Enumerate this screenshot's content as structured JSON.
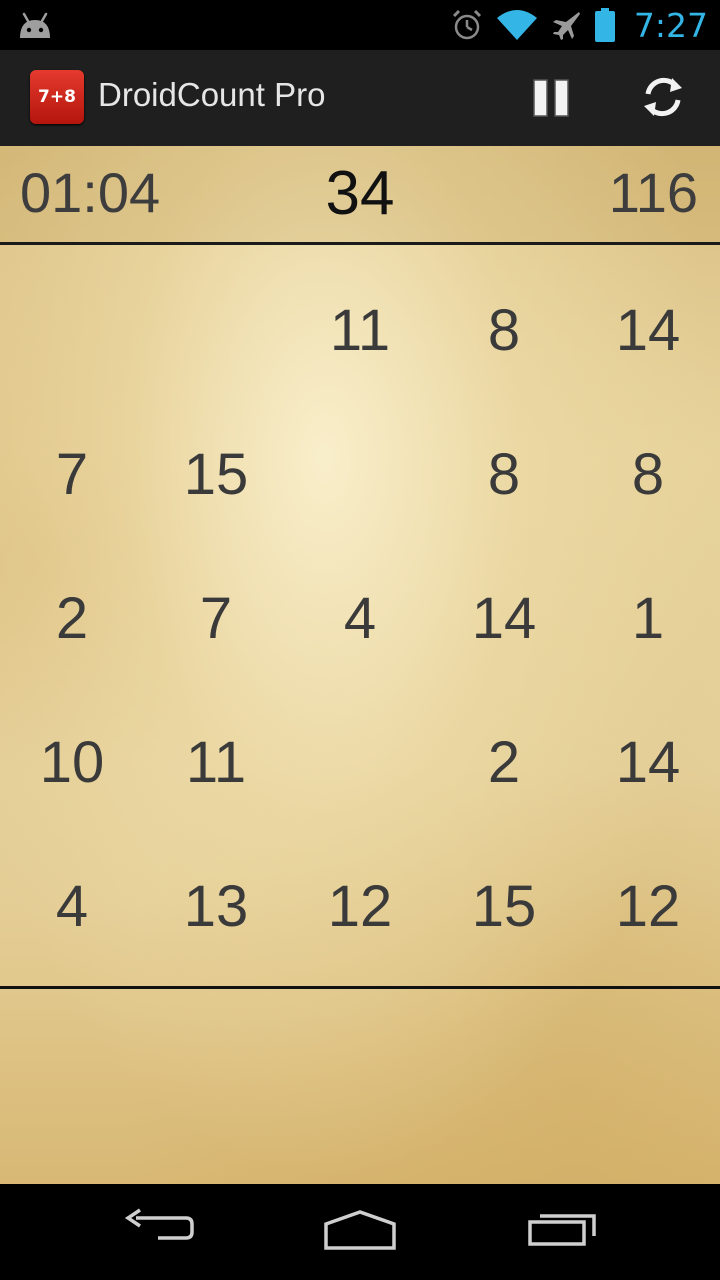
{
  "status_bar": {
    "time": "7:27",
    "icons": [
      "android-icon",
      "alarm-icon",
      "wifi-icon",
      "airplane-icon",
      "battery-icon"
    ],
    "clock_color": "#33b5e5"
  },
  "action_bar": {
    "app_icon_text": "7+8",
    "title": "DroidCount Pro",
    "actions": [
      "pause-icon",
      "refresh-icon"
    ]
  },
  "game": {
    "timer": "01:04",
    "target": "34",
    "score": "116",
    "grid": [
      [
        "",
        "",
        "11",
        "8",
        "14"
      ],
      [
        "7",
        "15",
        "",
        "8",
        "8"
      ],
      [
        "2",
        "7",
        "4",
        "14",
        "1"
      ],
      [
        "10",
        "11",
        "",
        "2",
        "14"
      ],
      [
        "4",
        "13",
        "12",
        "15",
        "12"
      ]
    ]
  },
  "nav_bar": {
    "buttons": [
      "back-icon",
      "home-icon",
      "recents-icon"
    ]
  }
}
